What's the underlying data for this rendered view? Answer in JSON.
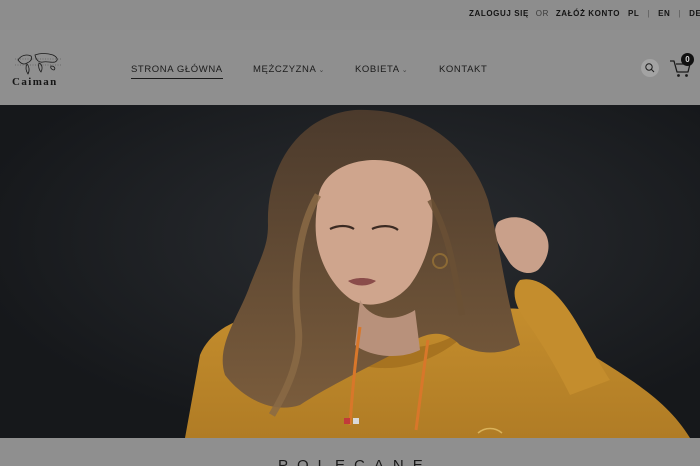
{
  "topbar": {
    "login_label": "ZALOGUJ SIĘ",
    "or_label": "OR",
    "register_label": "ZAŁÓŻ KONTO",
    "languages": [
      "PL",
      "EN",
      "DE"
    ]
  },
  "header": {
    "logo_text": "Caiman",
    "nav": [
      {
        "label": "STRONA GŁÓWNA",
        "active": true
      },
      {
        "label": "MĘŻCZYZNA",
        "dropdown": true
      },
      {
        "label": "KOBIETA",
        "dropdown": true
      },
      {
        "label": "KONTAKT"
      }
    ],
    "cart_count": "0",
    "icons": [
      "search-icon",
      "cart-icon"
    ]
  },
  "hero": {
    "slider_dots": 2,
    "active_dot": 1,
    "colors": {
      "hoodie": "#d6a23a",
      "background": "#1f2226",
      "dot_active": "#c23a3a",
      "dot_inactive": "#d9d9d9"
    }
  },
  "section": {
    "title": "POLECANE"
  }
}
